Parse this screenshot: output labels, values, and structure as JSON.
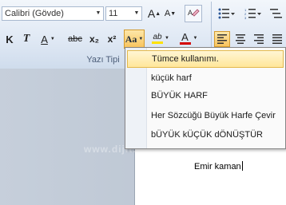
{
  "ribbon": {
    "font_name": "Calibri (Gövde)",
    "font_size": "11",
    "grow_font": "A",
    "shrink_font": "A",
    "bold": "K",
    "italic": "T",
    "underline": "A",
    "strikethrough": "abc",
    "subscript": "x₂",
    "superscript": "x²",
    "change_case": "Aa",
    "highlight": "ab",
    "font_color": "A",
    "group_label": "Yazı Tipi"
  },
  "change_case_menu": [
    {
      "label": "Tümce kullanımı."
    },
    {
      "label": "küçük harf"
    },
    {
      "label": "BÜYÜK HARF"
    },
    {
      "label": "Her Sözcüğü Büyük Harfe Çevir"
    },
    {
      "label": "bÜYÜK kÜÇÜK dÖNÜŞTÜR"
    }
  ],
  "document": {
    "text": "Emir kaman"
  },
  "watermark": "www.dijit...",
  "colors": {
    "highlight_yellow": "#ffe200",
    "font_red": "#d40000",
    "menu_hover": "#ffe69a"
  },
  "icons": [
    "bullets-icon",
    "numbering-icon",
    "clear-format-icon",
    "align-left-icon",
    "align-center-icon",
    "align-right-icon",
    "justify-icon"
  ]
}
